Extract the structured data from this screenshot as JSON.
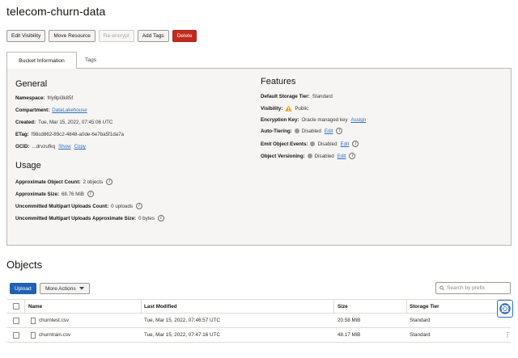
{
  "bucket": {
    "title": "telecom-churn-data"
  },
  "actions": {
    "edit_visibility": "Edit Visibility",
    "move_resource": "Move Resource",
    "reencrypt": "Re-encrypt",
    "add_tags": "Add Tags",
    "delete": "Delete"
  },
  "tabs": {
    "bucket_info": "Bucket Information",
    "tags": "Tags"
  },
  "general": {
    "heading": "General",
    "namespace_label": "Namespace:",
    "namespace_value": "frly8pi3k85f",
    "compartment_label": "Compartment:",
    "compartment_value": "DataLakehouse",
    "created_label": "Created:",
    "created_value": "Tue, Mar 15, 2022, 07:45:06 UTC",
    "etag_label": "ETag:",
    "etag_value": "f98cd862-89c2-4848-a0de-6e7ba5f1da7a",
    "ocid_label": "OCID:",
    "ocid_value": "...drvzufkq",
    "show": "Show",
    "copy": "Copy"
  },
  "usage": {
    "heading": "Usage",
    "obj_count_label": "Approximate Object Count:",
    "obj_count_value": "2 objects",
    "size_label": "Approximate Size:",
    "size_value": "68.76 MiB",
    "multipart_count_label": "Uncommitted Multipart Uploads Count:",
    "multipart_count_value": "0 uploads",
    "multipart_size_label": "Uncommitted Multipart Uploads Approximate Size:",
    "multipart_size_value": "0 bytes"
  },
  "features": {
    "heading": "Features",
    "storage_tier_label": "Default Storage Tier:",
    "storage_tier_value": "Standard",
    "visibility_label": "Visibility:",
    "visibility_value": "Public",
    "encryption_label": "Encryption Key:",
    "encryption_value": "Oracle managed key",
    "assign": "Assign",
    "autotiering_label": "Auto-Tiering:",
    "autotiering_value": "Disabled",
    "emit_label": "Emit Object Events:",
    "emit_value": "Disabled",
    "versioning_label": "Object Versioning:",
    "versioning_value": "Disabled",
    "edit": "Edit"
  },
  "objects": {
    "heading": "Objects",
    "upload": "Upload",
    "more_actions": "More Actions",
    "search_placeholder": "Search by prefix",
    "columns": {
      "name": "Name",
      "last_modified": "Last Modified",
      "size": "Size",
      "storage_tier": "Storage Tier"
    },
    "rows": [
      {
        "name": "churntest.csv",
        "last_modified": "Tue, Mar 15, 2022, 07:46:57 UTC",
        "size": "20.58 MiB",
        "storage_tier": "Standard"
      },
      {
        "name": "churntrain.csv",
        "last_modified": "Tue, Mar 15, 2022, 07:47:16 UTC",
        "size": "48.17 MiB",
        "storage_tier": "Standard"
      }
    ]
  },
  "colors": {
    "primary": "#1f61b4",
    "danger": "#c22a1e",
    "link": "#2f6ebd",
    "warning": "#e8a317"
  },
  "icons": [
    "info-icon",
    "warning-icon",
    "status-dot-icon",
    "search-icon",
    "chevron-down-icon",
    "file-icon",
    "kebab-icon",
    "help-lifebuoy-icon"
  ]
}
